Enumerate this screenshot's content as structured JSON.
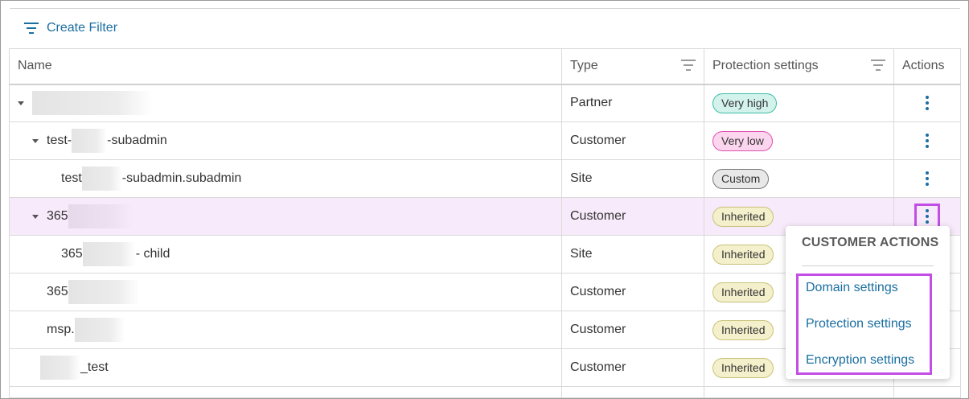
{
  "toolbar": {
    "create_filter_label": "Create Filter"
  },
  "table": {
    "columns": {
      "name": "Name",
      "type": "Type",
      "protection": "Protection settings",
      "actions": "Actions"
    },
    "rows": [
      {
        "name_prefix": "",
        "name_suffix": "",
        "type": "Partner",
        "protection": "Very high"
      },
      {
        "name_prefix": "test-",
        "name_suffix": "-subadmin",
        "type": "Customer",
        "protection": "Very low"
      },
      {
        "name_prefix": "test",
        "name_suffix": "-subadmin.subadmin",
        "type": "Site",
        "protection": "Custom"
      },
      {
        "name_prefix": "365",
        "name_suffix": "",
        "type": "Customer",
        "protection": "Inherited"
      },
      {
        "name_prefix": "365",
        "name_suffix": " - child",
        "type": "Site",
        "protection": "Inherited"
      },
      {
        "name_prefix": "365",
        "name_suffix": "",
        "type": "Customer",
        "protection": "Inherited"
      },
      {
        "name_prefix": "msp.",
        "name_suffix": "",
        "type": "Customer",
        "protection": "Inherited"
      },
      {
        "name_prefix": "",
        "name_suffix": "_test",
        "type": "Customer",
        "protection": "Inherited"
      }
    ]
  },
  "menu": {
    "title": "CUSTOMER ACTIONS",
    "items": [
      "Domain settings",
      "Protection settings",
      "Encryption settings"
    ]
  },
  "colors": {
    "accent": "#1a6ea0",
    "highlight_row": "#f7eafa",
    "annotation": "#c34ee6"
  }
}
